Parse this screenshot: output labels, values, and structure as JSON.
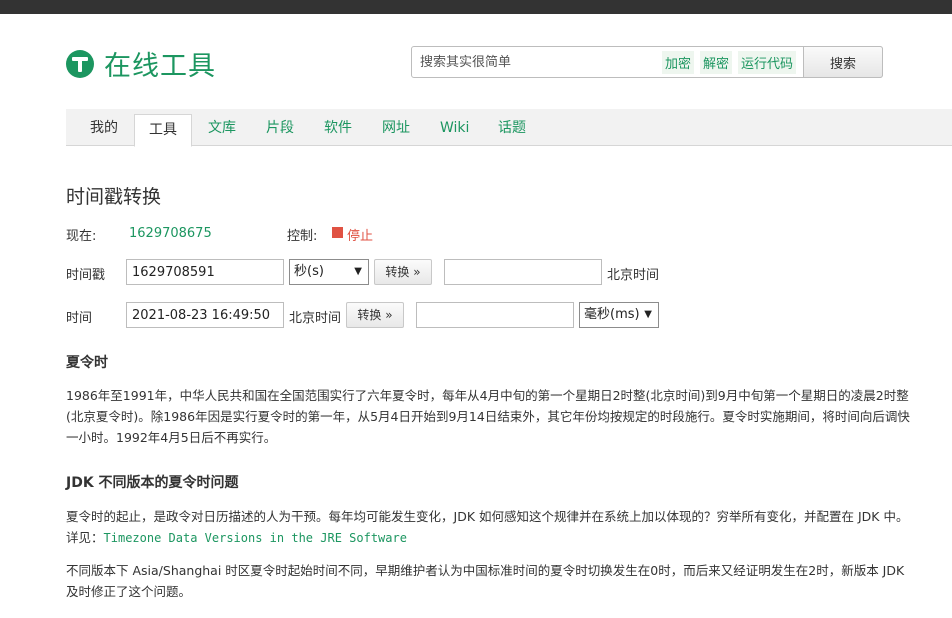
{
  "header": {
    "logo_text": "在线工具",
    "search": {
      "placeholder": "搜索其实很简单",
      "quick_links": [
        "加密",
        "解密",
        "运行代码"
      ],
      "button_label": "搜索"
    }
  },
  "nav": {
    "tabs": [
      "我的",
      "工具",
      "文库",
      "片段",
      "软件",
      "网址",
      "Wiki",
      "话题"
    ],
    "active": "工具"
  },
  "page": {
    "title": "时间戳转换",
    "now_label": "现在:",
    "now_value": "1629708675",
    "control_label": "控制:",
    "stop_label": "停止",
    "row1": {
      "label": "时间戳",
      "input_value": "1629708591",
      "unit_select": "秒(s)",
      "convert_label": "转换 »",
      "output_value": "",
      "suffix": "北京时间"
    },
    "row2": {
      "label": "时间",
      "input_value": "2021-08-23 16:49:50",
      "prefix": "北京时间",
      "convert_label": "转换 »",
      "output_value": "",
      "unit_select": "毫秒(ms)"
    }
  },
  "sections": {
    "dst_title": "夏令时",
    "dst_para_line1": "1986年至1991年，中华人民共和国在全国范围实行了六年夏令时，每年从4月中旬的第一个星期日2时整(北京时间)到9月中旬第一个星期日的凌晨2时整",
    "dst_para_line2": "(北京夏令时)。除1986年因是实行夏令时的第一年，从5月4日开始到9月14日结束外，其它年份均按规定的时段施行。夏令时实施期间，将时间向后调快",
    "dst_para_line3": "一小时。1992年4月5日后不再实行。",
    "jdk_title": "JDK 不同版本的夏令时问题",
    "jdk_para1_line1": "夏令时的起止，是政令对日历描述的人为干预。每年均可能发生变化，JDK 如何感知这个规律并在系统上加以体现的？穷举所有变化，并配置在 JDK 中。",
    "jdk_para1_prefix": "详见：",
    "jdk_link": "Timezone Data Versions in the JRE Software",
    "jdk_para2_line1": "不同版本下 Asia/Shanghai 时区夏令时起始时间不同，早期维护者认为中国标准时间的夏令时切换发生在0时，而后来又经证明发生在2时，新版本 JDK",
    "jdk_para2_line2": "及时修正了这个问题。"
  },
  "colors": {
    "brand": "#1c9660",
    "stop": "#e05243",
    "topbar": "#333333"
  }
}
